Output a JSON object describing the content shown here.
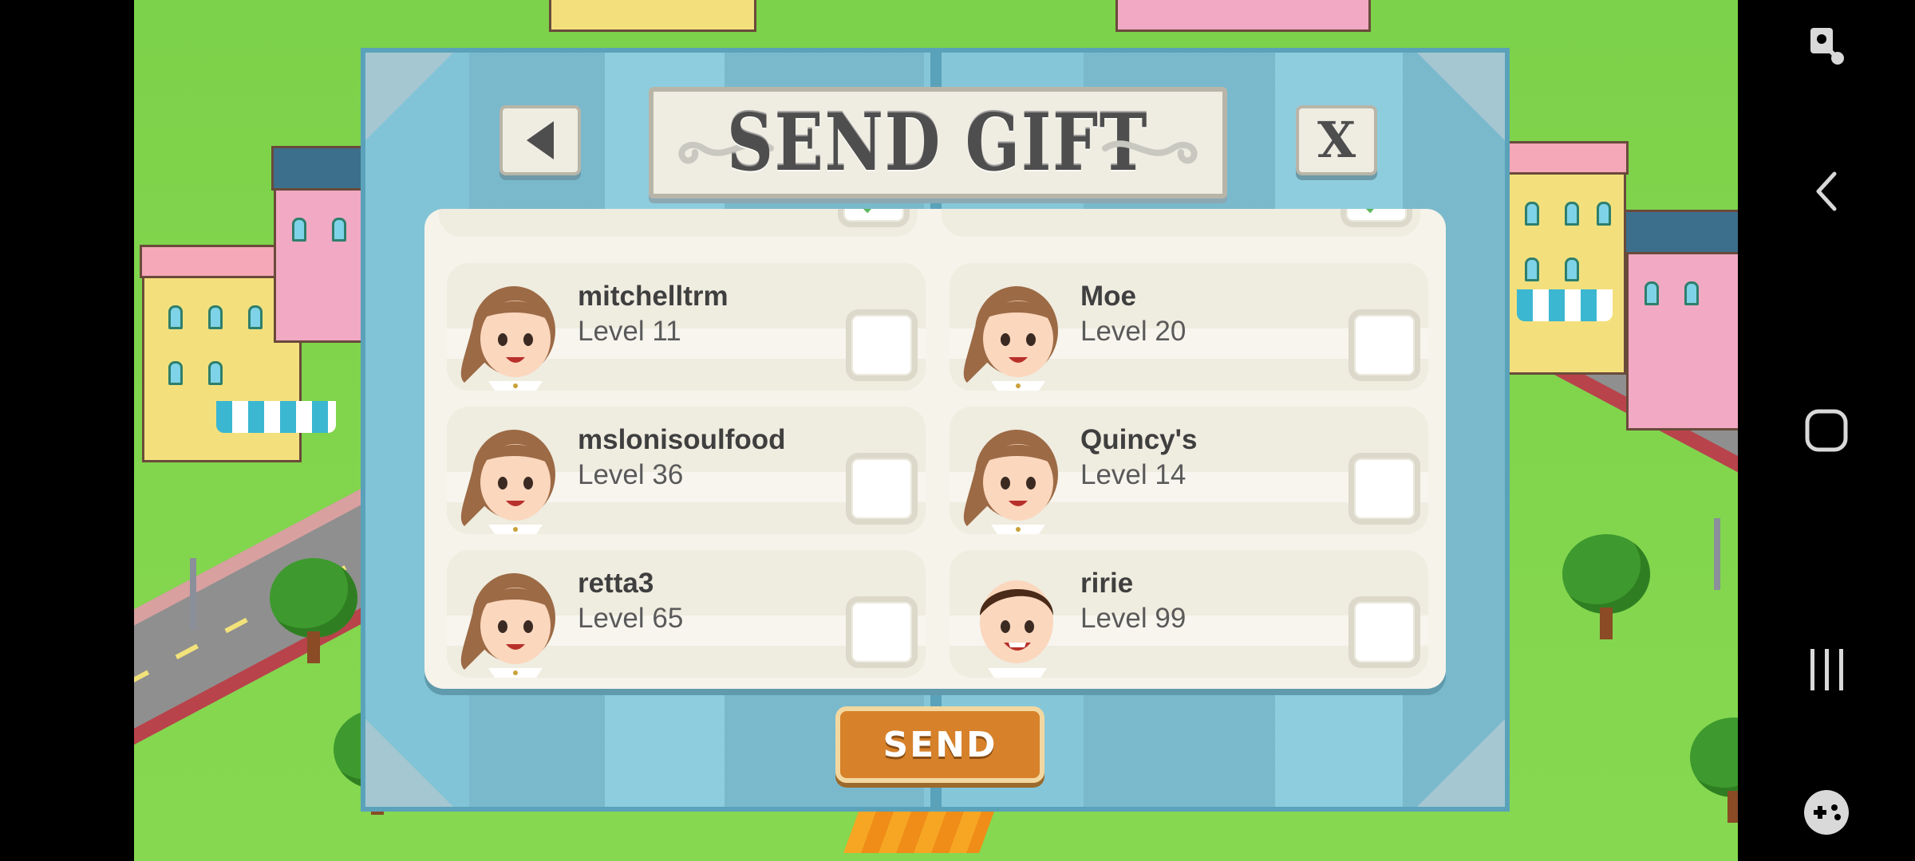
{
  "dialog": {
    "title": "SEND GIFT",
    "back_icon": "back-arrow-icon",
    "close_label": "X",
    "send_label": "SEND"
  },
  "friends": [
    {
      "name": "mitchelltrm",
      "level": "Level 11",
      "checked": false
    },
    {
      "name": "Moe",
      "level": "Level 20",
      "checked": false
    },
    {
      "name": "mslonisoulfood",
      "level": "Level 36",
      "checked": false
    },
    {
      "name": "Quincy's",
      "level": "Level 14",
      "checked": false
    },
    {
      "name": "retta3",
      "level": "Level 65",
      "checked": false
    },
    {
      "name": "ririe",
      "level": "Level 99",
      "checked": false
    }
  ],
  "partial_rows_above": {
    "checked": [
      true,
      true
    ]
  },
  "navbar": {
    "icons": [
      "screen-pin-icon",
      "back-icon",
      "home-icon",
      "recents-icon",
      "game-tools-icon"
    ]
  },
  "colors": {
    "dialog_blue": "#7cbcd0",
    "send_orange": "#d7812a",
    "grass": "#7cd24a"
  }
}
